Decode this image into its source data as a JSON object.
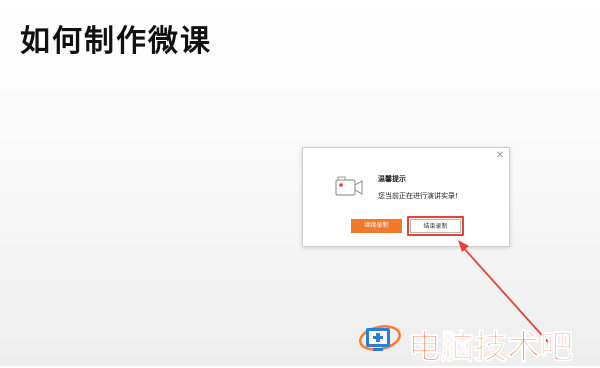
{
  "slide": {
    "title": "如何制作微课"
  },
  "dialog": {
    "title": "温馨提示",
    "message": "您当前正在进行演讲实录!",
    "close_symbol": "✕",
    "icon": "video-camera-icon",
    "buttons": {
      "continue_label": "继续录制",
      "end_label": "结束录制"
    }
  },
  "annotation": {
    "color": "#e8413a"
  },
  "watermark": {
    "text": "电脑技术吧",
    "color": "#ff5a1f"
  },
  "colors": {
    "primary_button": "#f07a2c"
  }
}
